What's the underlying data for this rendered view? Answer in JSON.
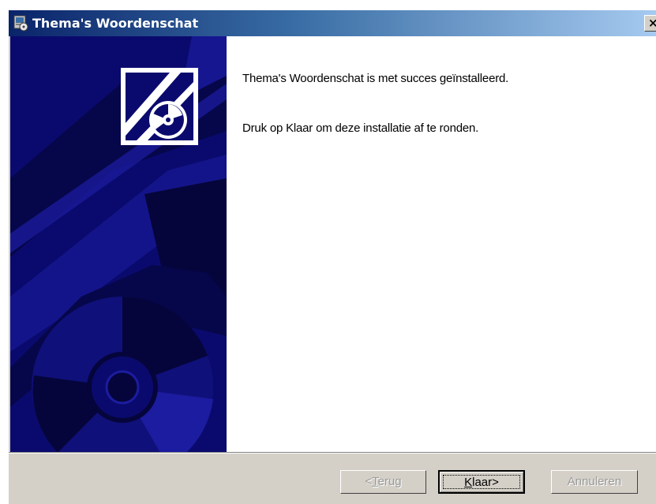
{
  "window": {
    "title": "Thema's Woordenschat",
    "close_label": "×"
  },
  "content": {
    "message_success": "Thema's Woordenschat is met succes geïnstalleerd.",
    "message_finish": "Druk op Klaar om deze installatie af te ronden."
  },
  "buttons": {
    "back": {
      "prefix": "<",
      "hotkey": "T",
      "rest": "erug",
      "enabled": false
    },
    "finish": {
      "hotkey": "K",
      "rest": "laar>",
      "enabled": true
    },
    "cancel": {
      "label": "Annuleren",
      "enabled": false
    }
  },
  "icons": {
    "app": "installer-icon",
    "banner_logo": "setup-logo-icon",
    "banner_graphic": "cd-disc-graphic"
  },
  "colors": {
    "titlebar_start": "#0a246a",
    "titlebar_end": "#a6caf0",
    "banner_bg": "#0a0a6e",
    "dialog_face": "#d4d0c8"
  }
}
